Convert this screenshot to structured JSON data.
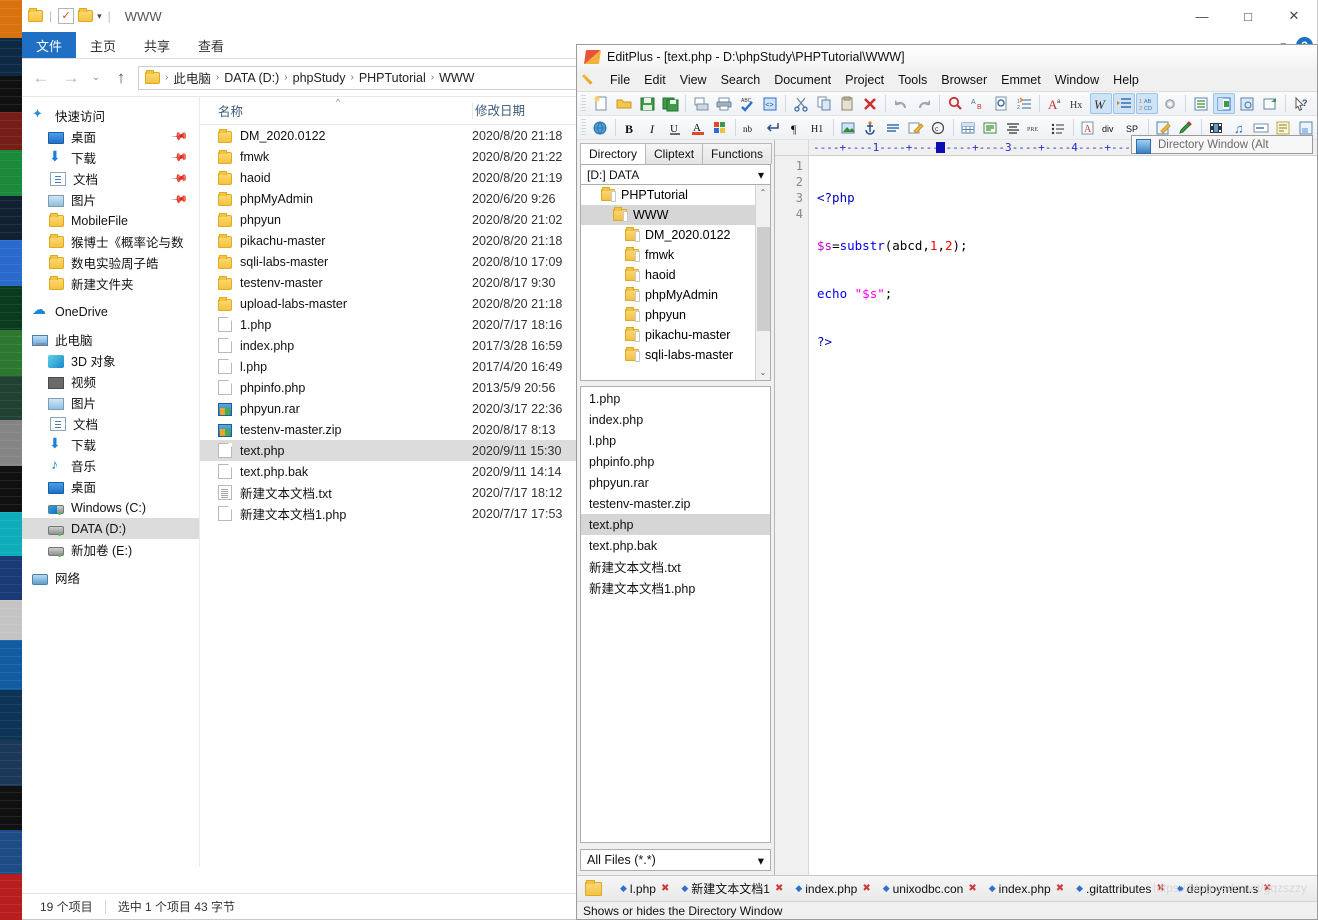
{
  "explorer": {
    "window_title": "WWW",
    "quick_access_icons": [
      "folder-icon",
      "properties-icon",
      "new-folder-icon",
      "customize-caret-icon"
    ],
    "window_controls": {
      "minimize": "—",
      "maximize": "□",
      "close": "✕"
    },
    "ribbon_tabs": [
      {
        "label": "文件",
        "active": true
      },
      {
        "label": "主页",
        "active": false
      },
      {
        "label": "共享",
        "active": false
      },
      {
        "label": "查看",
        "active": false
      }
    ],
    "ribbon_collapse_icon": "chevron-down-icon",
    "help_icon": "?",
    "nav": {
      "back_icon": "←",
      "forward_icon": "→",
      "recent_icon": "⌄",
      "up_icon": "↑",
      "breadcrumbs": [
        "此电脑",
        "DATA (D:)",
        "phpStudy",
        "PHPTutorial",
        "WWW"
      ],
      "separator": "›"
    },
    "tree": [
      {
        "label": "快速访问",
        "icon": "star-icon",
        "indent": 0,
        "pinned": false,
        "selected": false
      },
      {
        "label": "桌面",
        "icon": "monitor-icon",
        "indent": 1,
        "pinned": true,
        "selected": false
      },
      {
        "label": "下载",
        "icon": "download-icon",
        "indent": 1,
        "pinned": true,
        "selected": false
      },
      {
        "label": "文档",
        "icon": "document-icon",
        "indent": 1,
        "pinned": true,
        "selected": false
      },
      {
        "label": "图片",
        "icon": "picture-icon",
        "indent": 1,
        "pinned": true,
        "selected": false
      },
      {
        "label": "MobileFile",
        "icon": "folder-icon",
        "indent": 1,
        "pinned": false,
        "selected": false
      },
      {
        "label": "猴博士《概率论与数",
        "icon": "folder-icon",
        "indent": 1,
        "pinned": false,
        "selected": false
      },
      {
        "label": "数电实验周子皓",
        "icon": "folder-icon",
        "indent": 1,
        "pinned": false,
        "selected": false
      },
      {
        "label": "新建文件夹",
        "icon": "folder-icon",
        "indent": 1,
        "pinned": false,
        "selected": false
      },
      {
        "label": "OneDrive",
        "icon": "cloud-icon",
        "indent": 0,
        "pinned": false,
        "selected": false,
        "gap_before": true
      },
      {
        "label": "此电脑",
        "icon": "pc-icon",
        "indent": 0,
        "pinned": false,
        "selected": false,
        "gap_before": true
      },
      {
        "label": "3D 对象",
        "icon": "cube-icon",
        "indent": 1,
        "pinned": false,
        "selected": false
      },
      {
        "label": "视频",
        "icon": "video-icon",
        "indent": 1,
        "pinned": false,
        "selected": false
      },
      {
        "label": "图片",
        "icon": "picture-icon",
        "indent": 1,
        "pinned": false,
        "selected": false
      },
      {
        "label": "文档",
        "icon": "document-icon",
        "indent": 1,
        "pinned": false,
        "selected": false
      },
      {
        "label": "下载",
        "icon": "download-icon",
        "indent": 1,
        "pinned": false,
        "selected": false
      },
      {
        "label": "音乐",
        "icon": "music-icon",
        "indent": 1,
        "pinned": false,
        "selected": false
      },
      {
        "label": "桌面",
        "icon": "monitor-icon",
        "indent": 1,
        "pinned": false,
        "selected": false
      },
      {
        "label": "Windows (C:)",
        "icon": "drive-windows-icon",
        "indent": 1,
        "pinned": false,
        "selected": false
      },
      {
        "label": "DATA (D:)",
        "icon": "drive-icon",
        "indent": 1,
        "pinned": false,
        "selected": true
      },
      {
        "label": "新加卷 (E:)",
        "icon": "drive-icon",
        "indent": 1,
        "pinned": false,
        "selected": false
      },
      {
        "label": "网络",
        "icon": "network-icon",
        "indent": 0,
        "pinned": false,
        "selected": false,
        "gap_before": true
      }
    ],
    "columns": {
      "name": "名称",
      "date": "修改日期"
    },
    "files": [
      {
        "name": "DM_2020.0122",
        "date": "2020/8/20 21:18",
        "icon": "folder-icon",
        "selected": false
      },
      {
        "name": "fmwk",
        "date": "2020/8/20 21:22",
        "icon": "folder-icon",
        "selected": false
      },
      {
        "name": "haoid",
        "date": "2020/8/20 21:19",
        "icon": "folder-icon",
        "selected": false
      },
      {
        "name": "phpMyAdmin",
        "date": "2020/6/20 9:26",
        "icon": "folder-icon",
        "selected": false
      },
      {
        "name": "phpyun",
        "date": "2020/8/20 21:02",
        "icon": "folder-icon",
        "selected": false
      },
      {
        "name": "pikachu-master",
        "date": "2020/8/20 21:18",
        "icon": "folder-icon",
        "selected": false
      },
      {
        "name": "sqli-labs-master",
        "date": "2020/8/10 17:09",
        "icon": "folder-icon",
        "selected": false
      },
      {
        "name": "testenv-master",
        "date": "2020/8/17 9:30",
        "icon": "folder-icon",
        "selected": false
      },
      {
        "name": "upload-labs-master",
        "date": "2020/8/20 21:18",
        "icon": "folder-icon",
        "selected": false
      },
      {
        "name": "1.php",
        "date": "2020/7/17 18:16",
        "icon": "file-icon",
        "selected": false
      },
      {
        "name": "index.php",
        "date": "2017/3/28 16:59",
        "icon": "file-icon",
        "selected": false
      },
      {
        "name": "l.php",
        "date": "2017/4/20 16:49",
        "icon": "file-icon",
        "selected": false
      },
      {
        "name": "phpinfo.php",
        "date": "2013/5/9 20:56",
        "icon": "file-icon",
        "selected": false
      },
      {
        "name": "phpyun.rar",
        "date": "2020/3/17 22:36",
        "icon": "archive-icon",
        "selected": false
      },
      {
        "name": "testenv-master.zip",
        "date": "2020/8/17 8:13",
        "icon": "archive-icon",
        "selected": false
      },
      {
        "name": "text.php",
        "date": "2020/9/11 15:30",
        "icon": "file-icon",
        "selected": true
      },
      {
        "name": "text.php.bak",
        "date": "2020/9/11 14:14",
        "icon": "file-icon",
        "selected": false
      },
      {
        "name": "新建文本文档.txt",
        "date": "2020/7/17 18:12",
        "icon": "text-icon",
        "selected": false
      },
      {
        "name": "新建文本文档1.php",
        "date": "2020/7/17 17:53",
        "icon": "file-icon",
        "selected": false
      }
    ],
    "status": {
      "item_count": "19 个项目",
      "selection": "选中 1 个项目  43 字节"
    }
  },
  "editplus": {
    "title": "EditPlus - [text.php - D:\\phpStudy\\PHPTutorial\\WWW]",
    "app_icon": "editplus-logo-icon",
    "menu_icon": "pencil-icon",
    "menu": [
      "File",
      "Edit",
      "View",
      "Search",
      "Document",
      "Project",
      "Tools",
      "Browser",
      "Emmet",
      "Window",
      "Help"
    ],
    "toolbar_row1": [
      "new-file-icon",
      "open-file-icon",
      "save-icon",
      "save-all-icon",
      "|",
      "print-preview-icon",
      "print-icon",
      "spellcheck-icon",
      "source-code-icon",
      "|",
      "cut-icon",
      "copy-icon",
      "paste-icon",
      "delete-icon",
      "|",
      "undo-icon",
      "redo-icon",
      "|",
      "find-icon",
      "replace-icon",
      "find-in-files-icon",
      "goto-line-icon",
      "|",
      "font-icon",
      "hex-viewer-icon",
      "word-wrap-icon",
      "auto-indent-icon",
      "line-numbers-icon",
      "settings-icon",
      "|",
      "document-selector-icon",
      "directory-window-icon",
      "output-window-icon",
      "browser-preview-icon",
      "|",
      "help-pointer-icon"
    ],
    "toolbar_row2": [
      "globe-icon",
      "|",
      "bold-icon",
      "italic-icon",
      "underline-icon",
      "font-color-icon",
      "palette-icon",
      "|",
      "nbsp-icon",
      "line-break-icon",
      "paragraph-icon",
      "heading-icon",
      "|",
      "image-icon",
      "anchor-icon",
      "hr-icon",
      "edit-link-icon",
      "copyright-icon",
      "|",
      "table-icon",
      "form-icon",
      "align-icon",
      "pre-icon",
      "list-icon",
      "|",
      "font-tag-icon",
      "div-tag-icon",
      "span-tag-icon",
      "|",
      "edit-doc-icon",
      "highlight-icon",
      "|",
      "media-icon",
      "audio-icon",
      "marquee-icon",
      "applet-icon",
      "object-icon"
    ],
    "tooltip": "Directory Window (Alt",
    "tooltip_icon": "directory-window-icon",
    "dir_panel": {
      "tabs": [
        {
          "label": "Directory",
          "active": true
        },
        {
          "label": "Cliptext",
          "active": false
        },
        {
          "label": "Functions",
          "active": false
        }
      ],
      "drive_selector": "[D:] DATA",
      "drive_caret": "chevron-down-icon",
      "tree": [
        {
          "label": "PHPTutorial",
          "indent": 1,
          "selected": false
        },
        {
          "label": "WWW",
          "indent": 2,
          "selected": true
        },
        {
          "label": "DM_2020.0122",
          "indent": 3,
          "selected": false
        },
        {
          "label": "fmwk",
          "indent": 3,
          "selected": false
        },
        {
          "label": "haoid",
          "indent": 3,
          "selected": false
        },
        {
          "label": "phpMyAdmin",
          "indent": 3,
          "selected": false
        },
        {
          "label": "phpyun",
          "indent": 3,
          "selected": false
        },
        {
          "label": "pikachu-master",
          "indent": 3,
          "selected": false
        },
        {
          "label": "sqli-labs-master",
          "indent": 3,
          "selected": false
        }
      ],
      "scroll_up_icon": "⌃",
      "scroll_down_icon": "⌄",
      "files": [
        {
          "name": "1.php",
          "selected": false
        },
        {
          "name": "index.php",
          "selected": false
        },
        {
          "name": "l.php",
          "selected": false
        },
        {
          "name": "phpinfo.php",
          "selected": false
        },
        {
          "name": "phpyun.rar",
          "selected": false
        },
        {
          "name": "testenv-master.zip",
          "selected": false
        },
        {
          "name": "text.php",
          "selected": true
        },
        {
          "name": "text.php.bak",
          "selected": false
        },
        {
          "name": "新建文本文档.txt",
          "selected": false
        },
        {
          "name": "新建文本文档1.php",
          "selected": false
        }
      ],
      "filter": "All Files (*.*)",
      "filter_caret": "chevron-down-icon"
    },
    "editor": {
      "ruler": "----+----1----+----2----+----3----+----4----+----5----+----6----+----7",
      "current_line": 2,
      "lines": [
        {
          "no": "1",
          "text": "<?php"
        },
        {
          "no": "2",
          "text": "$s=substr(abcd,1,2);"
        },
        {
          "no": "3",
          "text": "echo \"$s\";"
        },
        {
          "no": "4",
          "text": "?>"
        }
      ]
    },
    "file_tabs": [
      {
        "label": "l.php"
      },
      {
        "label": "新建文本文档1"
      },
      {
        "label": "index.php"
      },
      {
        "label": "unixodbc.con"
      },
      {
        "label": "index.php"
      },
      {
        "label": ".gitattributes"
      },
      {
        "label": "deployment.s"
      }
    ],
    "tab_folder_icon": "folder-icon",
    "status_text": "Shows or hides the Directory Window",
    "watermark": "https://blog.csdn.net/gqzszzy"
  }
}
